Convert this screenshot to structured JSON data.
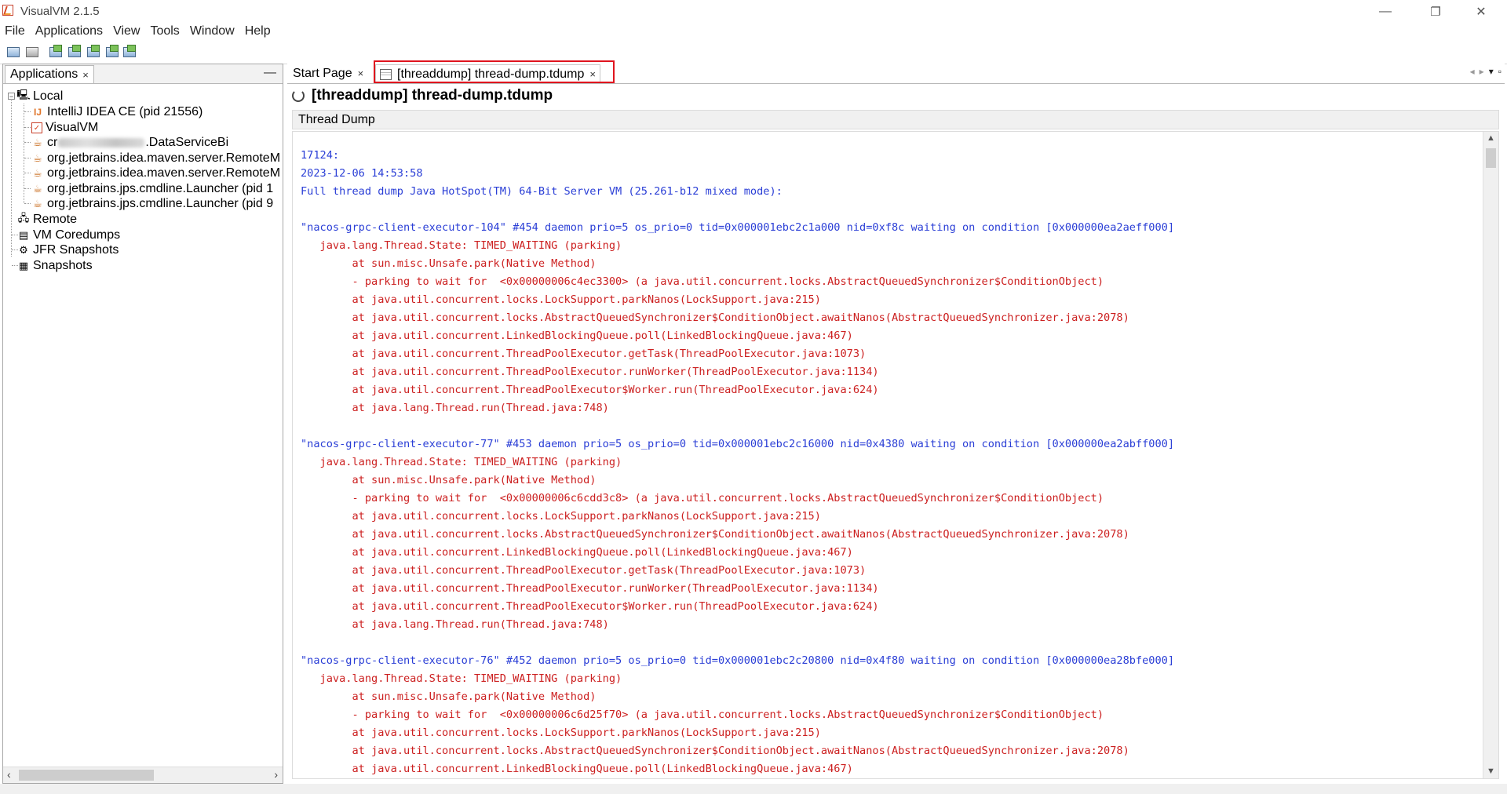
{
  "window": {
    "title": "VisualVM 2.1.5",
    "controls": {
      "minimize": "—",
      "restore": "❐",
      "close": "✕"
    }
  },
  "menubar": [
    "File",
    "Applications",
    "View",
    "Tools",
    "Window",
    "Help"
  ],
  "toolbar": [
    "load-snapshot-icon",
    "save-icon",
    "add-jmx-connection-icon",
    "add-remote-host-icon",
    "add-vm-coredump-icon",
    "add-jfr-snapshot-icon"
  ],
  "left_panel": {
    "tab_label": "Applications",
    "close": "×",
    "minimize": "—",
    "tree": {
      "local": "Local",
      "local_children": [
        {
          "label": "IntelliJ IDEA CE (pid 21556)",
          "icon": "intellij-icon"
        },
        {
          "label": "VisualVM",
          "icon": "visualvm-icon"
        },
        {
          "label_prefix": "cr",
          "label_suffix": ".DataServiceBi",
          "icon": "java-icon"
        },
        {
          "label": "org.jetbrains.idea.maven.server.RemoteM",
          "icon": "java-icon"
        },
        {
          "label": "org.jetbrains.idea.maven.server.RemoteM",
          "icon": "java-icon"
        },
        {
          "label": "org.jetbrains.jps.cmdline.Launcher (pid 1",
          "icon": "java-icon"
        },
        {
          "label": "org.jetbrains.jps.cmdline.Launcher (pid 9",
          "icon": "java-icon"
        }
      ],
      "remote": "Remote",
      "vm_coredumps": "VM Coredumps",
      "jfr_snapshots": "JFR Snapshots",
      "snapshots": "Snapshots"
    }
  },
  "editor": {
    "tabs": [
      {
        "label": "Start Page",
        "close": "×"
      },
      {
        "label": "[threaddump] thread-dump.tdump",
        "close": "×"
      }
    ],
    "title": "[threaddump] thread-dump.tdump",
    "subheader": "Thread Dump",
    "lines": [
      {
        "t": "17124:",
        "c": "blue"
      },
      {
        "t": "2023-12-06 14:53:58",
        "c": "blue"
      },
      {
        "t": "Full thread dump Java HotSpot(TM) 64-Bit Server VM (25.261-b12 mixed mode):",
        "c": "blue"
      },
      {
        "t": "",
        "c": "blue"
      },
      {
        "t": "\"nacos-grpc-client-executor-104\" #454 daemon prio=5 os_prio=0 tid=0x000001ebc2c1a000 nid=0xf8c waiting on condition [0x000000ea2aeff000]",
        "c": "blue"
      },
      {
        "t": "   java.lang.Thread.State: TIMED_WAITING (parking)",
        "c": "red"
      },
      {
        "t": "        at sun.misc.Unsafe.park(Native Method)",
        "c": "red"
      },
      {
        "t": "        - parking to wait for  <0x00000006c4ec3300> (a java.util.concurrent.locks.AbstractQueuedSynchronizer$ConditionObject)",
        "c": "red"
      },
      {
        "t": "        at java.util.concurrent.locks.LockSupport.parkNanos(LockSupport.java:215)",
        "c": "red"
      },
      {
        "t": "        at java.util.concurrent.locks.AbstractQueuedSynchronizer$ConditionObject.awaitNanos(AbstractQueuedSynchronizer.java:2078)",
        "c": "red"
      },
      {
        "t": "        at java.util.concurrent.LinkedBlockingQueue.poll(LinkedBlockingQueue.java:467)",
        "c": "red"
      },
      {
        "t": "        at java.util.concurrent.ThreadPoolExecutor.getTask(ThreadPoolExecutor.java:1073)",
        "c": "red"
      },
      {
        "t": "        at java.util.concurrent.ThreadPoolExecutor.runWorker(ThreadPoolExecutor.java:1134)",
        "c": "red"
      },
      {
        "t": "        at java.util.concurrent.ThreadPoolExecutor$Worker.run(ThreadPoolExecutor.java:624)",
        "c": "red"
      },
      {
        "t": "        at java.lang.Thread.run(Thread.java:748)",
        "c": "red"
      },
      {
        "t": "",
        "c": "blue"
      },
      {
        "t": "\"nacos-grpc-client-executor-77\" #453 daemon prio=5 os_prio=0 tid=0x000001ebc2c16000 nid=0x4380 waiting on condition [0x000000ea2abff000]",
        "c": "blue"
      },
      {
        "t": "   java.lang.Thread.State: TIMED_WAITING (parking)",
        "c": "red"
      },
      {
        "t": "        at sun.misc.Unsafe.park(Native Method)",
        "c": "red"
      },
      {
        "t": "        - parking to wait for  <0x00000006c6cdd3c8> (a java.util.concurrent.locks.AbstractQueuedSynchronizer$ConditionObject)",
        "c": "red"
      },
      {
        "t": "        at java.util.concurrent.locks.LockSupport.parkNanos(LockSupport.java:215)",
        "c": "red"
      },
      {
        "t": "        at java.util.concurrent.locks.AbstractQueuedSynchronizer$ConditionObject.awaitNanos(AbstractQueuedSynchronizer.java:2078)",
        "c": "red"
      },
      {
        "t": "        at java.util.concurrent.LinkedBlockingQueue.poll(LinkedBlockingQueue.java:467)",
        "c": "red"
      },
      {
        "t": "        at java.util.concurrent.ThreadPoolExecutor.getTask(ThreadPoolExecutor.java:1073)",
        "c": "red"
      },
      {
        "t": "        at java.util.concurrent.ThreadPoolExecutor.runWorker(ThreadPoolExecutor.java:1134)",
        "c": "red"
      },
      {
        "t": "        at java.util.concurrent.ThreadPoolExecutor$Worker.run(ThreadPoolExecutor.java:624)",
        "c": "red"
      },
      {
        "t": "        at java.lang.Thread.run(Thread.java:748)",
        "c": "red"
      },
      {
        "t": "",
        "c": "blue"
      },
      {
        "t": "\"nacos-grpc-client-executor-76\" #452 daemon prio=5 os_prio=0 tid=0x000001ebc2c20800 nid=0x4f80 waiting on condition [0x000000ea28bfe000]",
        "c": "blue"
      },
      {
        "t": "   java.lang.Thread.State: TIMED_WAITING (parking)",
        "c": "red"
      },
      {
        "t": "        at sun.misc.Unsafe.park(Native Method)",
        "c": "red"
      },
      {
        "t": "        - parking to wait for  <0x00000006c6d25f70> (a java.util.concurrent.locks.AbstractQueuedSynchronizer$ConditionObject)",
        "c": "red"
      },
      {
        "t": "        at java.util.concurrent.locks.LockSupport.parkNanos(LockSupport.java:215)",
        "c": "red"
      },
      {
        "t": "        at java.util.concurrent.locks.AbstractQueuedSynchronizer$ConditionObject.awaitNanos(AbstractQueuedSynchronizer.java:2078)",
        "c": "red"
      },
      {
        "t": "        at java.util.concurrent.LinkedBlockingQueue.poll(LinkedBlockingQueue.java:467)",
        "c": "red"
      }
    ]
  },
  "colors": {
    "text_blue": "#2a3ed6",
    "text_red": "#cc2020",
    "highlight_border": "#e0141e"
  }
}
